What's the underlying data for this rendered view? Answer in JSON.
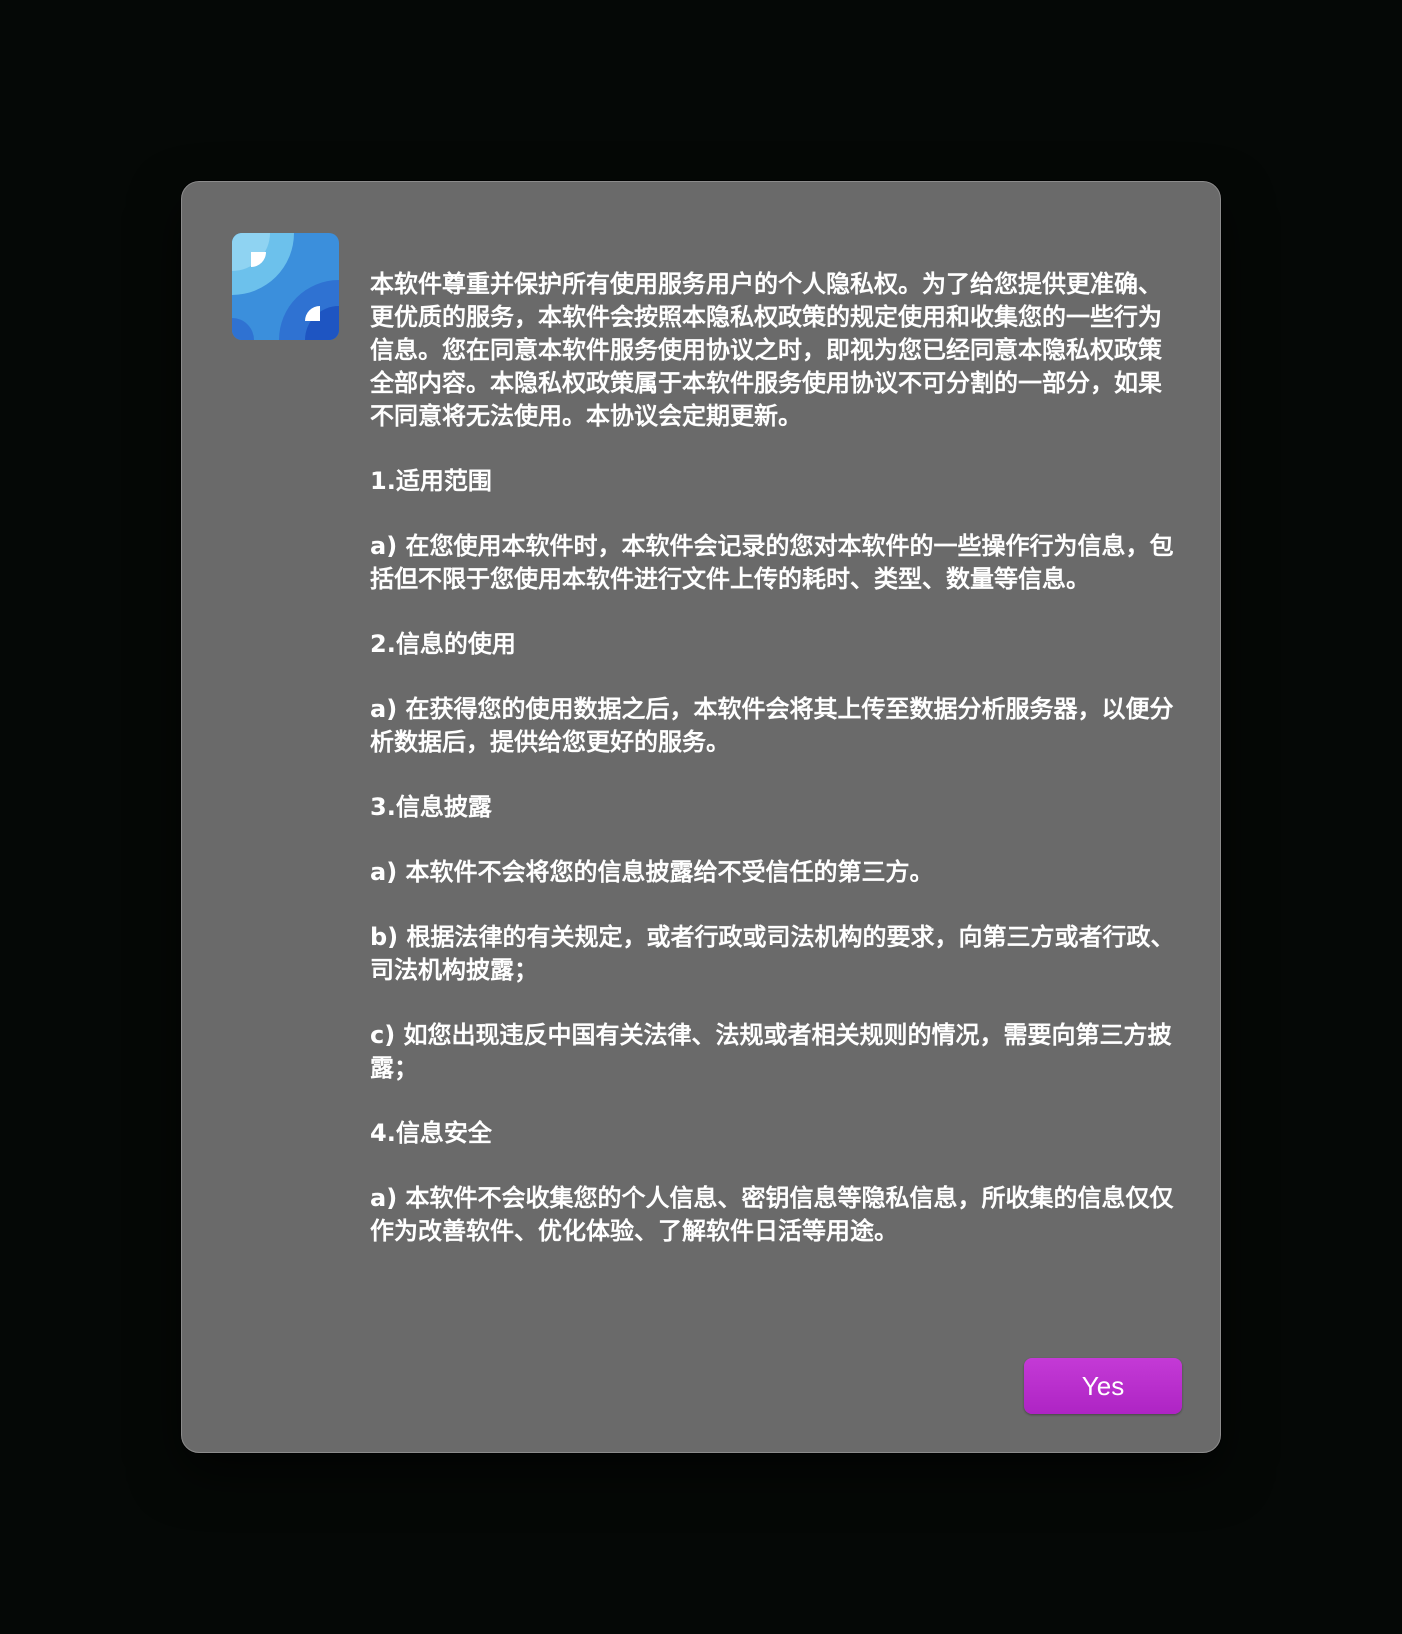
{
  "dialog": {
    "icon": "app-icon-blue-shapes",
    "paragraphs": [
      "本软件尊重并保护所有使用服务用户的个人隐私权。为了给您提供更准确、更优质的服务，本软件会按照本隐私权政策的规定使用和收集您的一些行为信息。您在同意本软件服务使用协议之时，即视为您已经同意本隐私权政策全部内容。本隐私权政策属于本软件服务使用协议不可分割的一部分，如果不同意将无法使用。本协议会定期更新。",
      "1.适用范围",
      "a) 在您使用本软件时，本软件会记录的您对本软件的一些操作行为信息，包括但不限于您使用本软件进行文件上传的耗时、类型、数量等信息。",
      "2.信息的使用",
      "a) 在获得您的使用数据之后，本软件会将其上传至数据分析服务器，以便分析数据后，提供给您更好的服务。",
      "3.信息披露",
      "a) 本软件不会将您的信息披露给不受信任的第三方。",
      "b) 根据法律的有关规定，或者行政或司法机构的要求，向第三方或者行政、司法机构披露；",
      "c) 如您出现违反中国有关法律、法规或者相关规则的情况，需要向第三方披露；",
      "4.信息安全",
      "a) 本软件不会收集您的个人信息、密钥信息等隐私信息，所收集的信息仅仅作为改善软件、优化体验、了解软件日活等用途。"
    ],
    "yes_label": "Yes"
  },
  "colors": {
    "background": "#050806",
    "dialog": "#6a6a6a",
    "text": "#ffffff",
    "button": "#b92ecd"
  }
}
